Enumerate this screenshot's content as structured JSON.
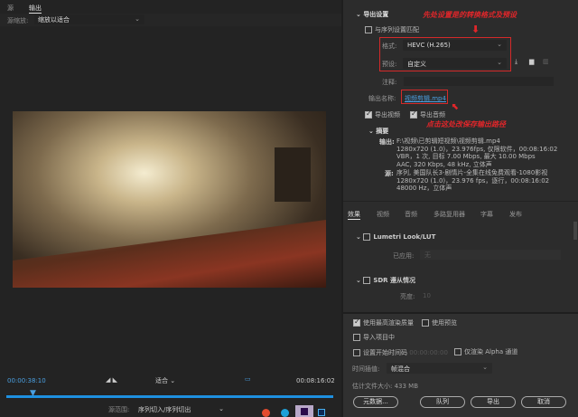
{
  "left": {
    "tabs": [
      "源",
      "输出"
    ],
    "scale_label": "源缩放:",
    "scale_value": "缩放以适合",
    "timecode_current": "00:00:38:10",
    "fit_value": "适合",
    "timecode_total": "00:08:16:02",
    "range_label": "源范围:",
    "range_value": "序列切入/序列切出"
  },
  "export": {
    "section_title": "导出设置",
    "match_sequence": "与序列设置匹配",
    "format_label": "格式:",
    "format_value": "HEVC (H.265)",
    "preset_label": "预设:",
    "preset_value": "自定义",
    "comment_label": "注释:",
    "output_name_label": "输出名称:",
    "output_name_value": "视频剪辑.mp4",
    "export_video": "导出视频",
    "export_audio": "导出音频",
    "annotation_top": "先处设置是的转换格式及预设",
    "annotation_bottom": "点击这处改保存输出路径"
  },
  "summary": {
    "title": "摘要",
    "output_label": "输出:",
    "output_lines": [
      "F:\\视频\\已剪辑短视频\\视频剪辑.mp4",
      "1280x720 (1.0)，23.976fps, 仅限软件，00:08:16:02",
      "VBR，1 次, 目标 7.00 Mbps, 最大 10.00 Mbps",
      "AAC, 320 Kbps, 48 kHz, 立体声"
    ],
    "source_label": "源:",
    "source_lines": [
      "序列, 美国队长3-剧情片-全集在线免费观看-1080影视",
      "1280x720 (1.0)，23.976 fps，逐行，00:08:16:02",
      "48000 Hz，立体声"
    ]
  },
  "tabs": [
    "效果",
    "视频",
    "音频",
    "多路复用器",
    "字幕",
    "发布"
  ],
  "effects": {
    "lumetri": "Lumetri Look/LUT",
    "applied_label": "已应用:",
    "applied_value": "无",
    "sdr": "SDR 遵从情况",
    "brightness_label": "亮度:",
    "brightness_value": "10"
  },
  "bottom": {
    "max_quality": "使用最高渲染质量",
    "use_preview": "使用预览",
    "import_project": "导入项目中",
    "set_start_tc": "设置开始时间码",
    "start_tc_value": "00:00:00:00",
    "alpha_only": "仅渲染 Alpha 通道",
    "time_interp_label": "时间插值:",
    "time_interp_value": "帧混合",
    "filesize_label": "估计文件大小:",
    "filesize_value": "433 MB",
    "metadata_btn": "元数据...",
    "queue_btn": "队列",
    "export_btn": "导出",
    "cancel_btn": "取消"
  },
  "playhead_fraction": 0.077
}
